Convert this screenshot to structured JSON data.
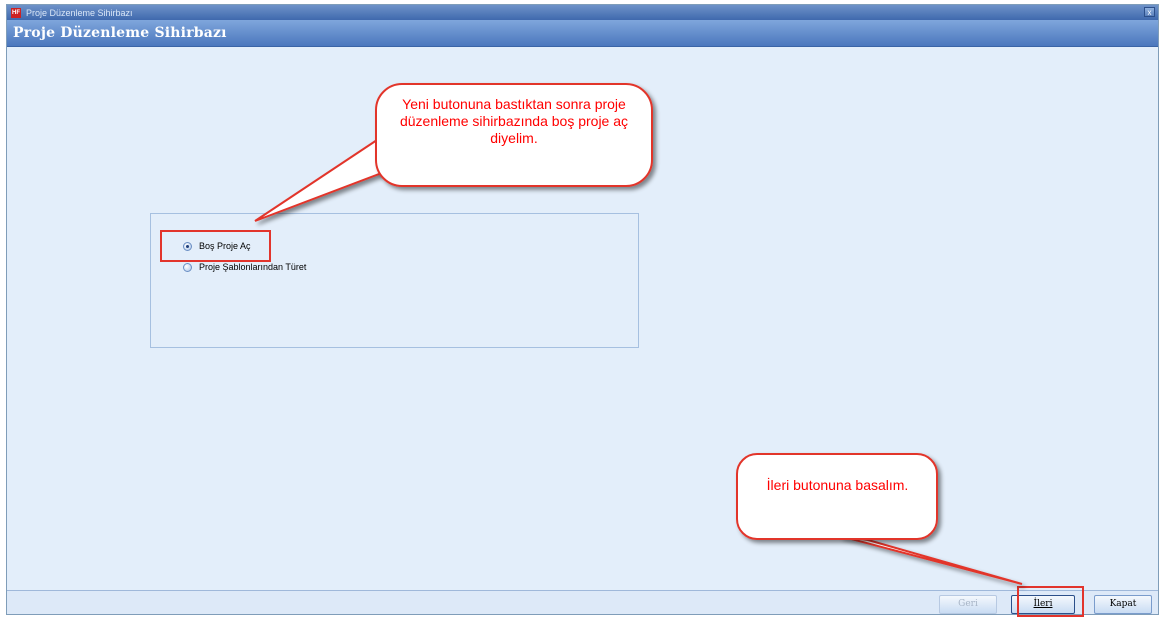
{
  "window": {
    "title": "Proje Düzenleme Sihirbazı",
    "header_title": "Proje Düzenleme Sihirbazı",
    "close_glyph": "x",
    "app_icon_text": "HF"
  },
  "options": [
    {
      "label": "Boş Proje Aç",
      "selected": true
    },
    {
      "label": "Proje Şablonlarından Türet",
      "selected": false
    }
  ],
  "buttons": {
    "back_label": "Geri",
    "next_label": "İleri",
    "close_label": "Kapat"
  },
  "annotations": {
    "callout_top": "Yeni butonuna bastıktan sonra proje düzenleme sihirbazında boş proje aç diyelim.",
    "callout_bottom": "İleri butonuna basalım.",
    "callout_color": "#e2342c"
  },
  "colors": {
    "window_bg": "#e3eefa",
    "header_bg": "#4b77bd",
    "highlight": "#e2342c"
  }
}
